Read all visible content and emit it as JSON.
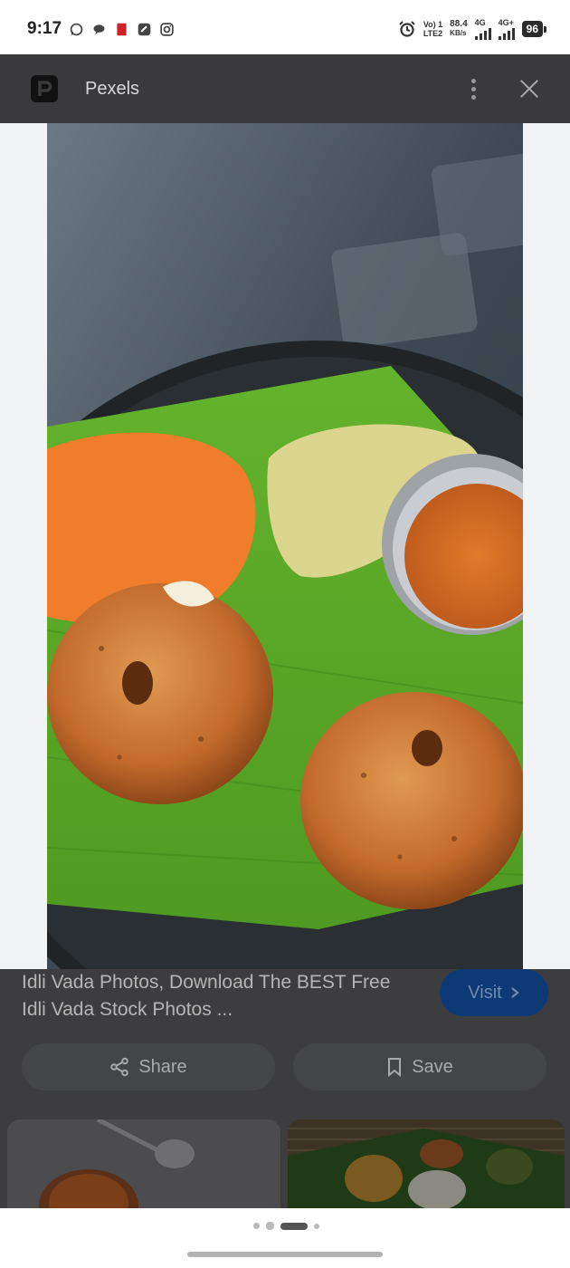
{
  "status_bar": {
    "time": "9:17",
    "left_icons": [
      "whatsapp-icon",
      "chat-bubble-icon",
      "red-app-icon",
      "link-app-icon",
      "instagram-icon"
    ],
    "carrier_line1": "Vo) 1",
    "carrier_line2": "LTE2",
    "speed_value": "88.4",
    "speed_unit": "KB/s",
    "network1": "4G",
    "network2": "4G+",
    "battery": "96"
  },
  "header": {
    "app_name": "Pexels",
    "icons": [
      "pexels-logo",
      "more-vert-icon",
      "close-icon"
    ]
  },
  "result": {
    "title": "Idli Vada Photos, Download The BEST Free Idli Vada Stock Photos ...",
    "visit_label": "Visit",
    "share_label": "Share",
    "save_label": "Save"
  },
  "pager": {
    "dot_count": 4,
    "active_index": 2
  },
  "colors": {
    "header_bg": "#3a3a3c",
    "visit_bg": "#0d3a75",
    "leaf_green": "#5cab28",
    "vada_brown": "#c36a2a"
  }
}
